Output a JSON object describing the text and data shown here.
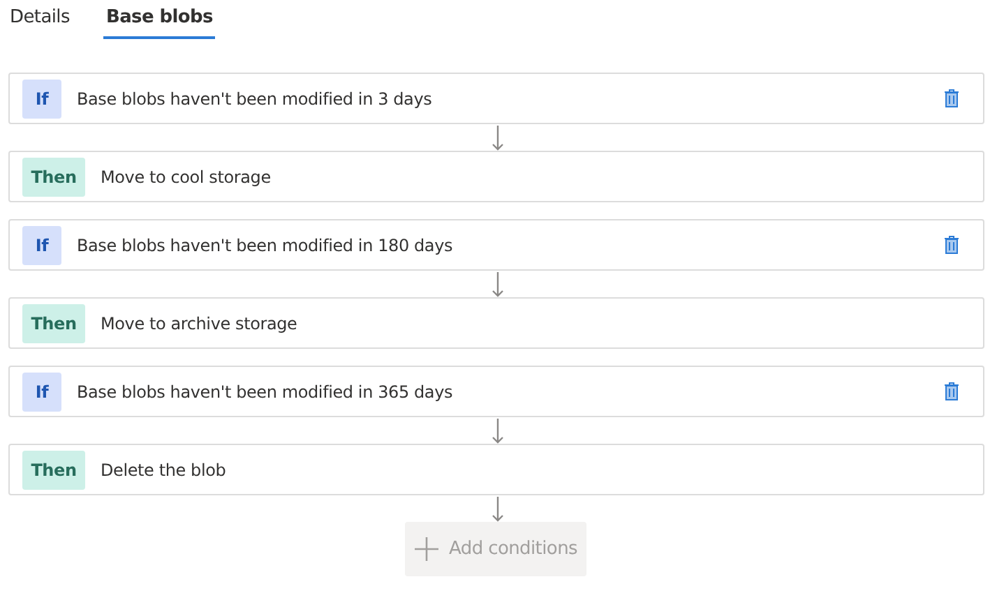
{
  "tabs": [
    {
      "label": "Details",
      "selected": false
    },
    {
      "label": "Base blobs",
      "selected": true
    }
  ],
  "steps": [
    {
      "kind": "if",
      "label": "If",
      "text": "Base blobs haven't been modified in 3 days"
    },
    {
      "kind": "then",
      "label": "Then",
      "text": "Move to cool storage"
    },
    {
      "kind": "if",
      "label": "If",
      "text": "Base blobs haven't been modified in 180 days"
    },
    {
      "kind": "then",
      "label": "Then",
      "text": "Move to archive storage"
    },
    {
      "kind": "if",
      "label": "If",
      "text": "Base blobs haven't been modified in 365 days"
    },
    {
      "kind": "then",
      "label": "Then",
      "text": "Delete the blob"
    }
  ],
  "add_button": {
    "label": "Add conditions",
    "disabled": true
  }
}
